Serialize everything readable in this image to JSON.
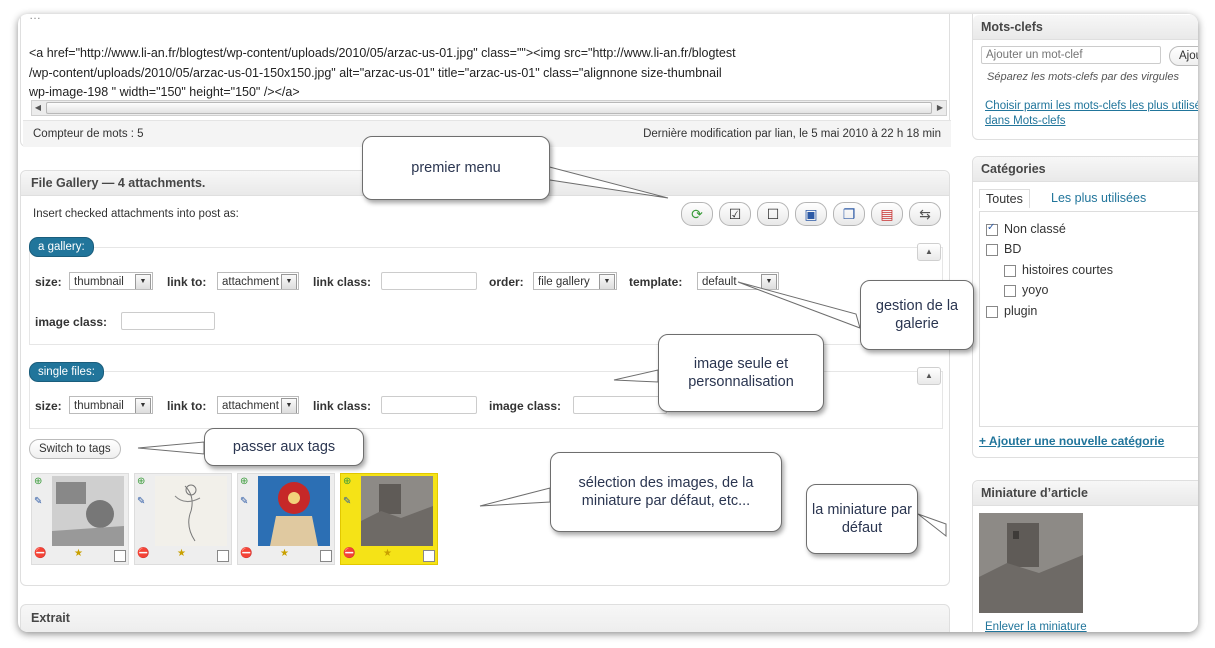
{
  "editor": {
    "code_line1": "<a href=\"http://www.li-an.fr/blogtest/wp-content/uploads/2010/05/arzac-us-01.jpg\" class=\"\"><img src=\"http://www.li-an.fr/blogtest",
    "code_line2": "/wp-content/uploads/2010/05/arzac-us-01-150x150.jpg\" alt=\"arzac-us-01\" title=\"arzac-us-01\"  class=\"alignnone size-thumbnail",
    "code_line3": "wp-image-198 \" width=\"150\" height=\"150\" /></a>",
    "word_count": "Compteur de mots : 5",
    "last_modified": "Dernière modification par lian, le 5 mai 2010 à 22 h 18 min"
  },
  "gallery": {
    "title": "File Gallery — 4 attachments.",
    "insert_label": "Insert checked attachments into post as:",
    "toolbar_icons": [
      "refresh-icon",
      "check-all-icon",
      "uncheck-all-icon",
      "insert-icon",
      "copy-icon",
      "save-icon",
      "swap-icon"
    ],
    "gallery_pill": "a gallery:",
    "single_pill": "single files:",
    "size_label": "size:",
    "link_to_label": "link to:",
    "link_class_label": "link class:",
    "order_label": "order:",
    "template_label": "template:",
    "image_class_label": "image class:",
    "size_value": "thumbnail",
    "link_to_value": "attachment",
    "order_value": "file gallery",
    "template_value": "default",
    "switch_button": "Switch to tags"
  },
  "callouts": {
    "premier_menu": "premier menu",
    "gestion": "gestion de la galerie",
    "image_seule": "image seule et personnalisation",
    "passer": "passer aux tags",
    "selection": "sélection des images, de la miniature par défaut, etc...",
    "miniature": "la miniature par défaut"
  },
  "tags_box": {
    "title": "Mots-clefs",
    "placeholder": "Ajouter un mot-clef",
    "add_button": "Ajouter",
    "hint": "Séparez les mots-clefs par des virgules",
    "choose_link": "Choisir parmi les mots-clefs les plus utilisés dans Mots-clefs"
  },
  "categories_box": {
    "title": "Catégories",
    "tab_all": "Toutes",
    "tab_popular": "Les plus utilisées",
    "items": [
      {
        "label": "Non classé",
        "checked": true
      },
      {
        "label": "BD",
        "checked": false
      },
      {
        "label": "histoires courtes",
        "checked": false
      },
      {
        "label": "yoyo",
        "checked": false
      },
      {
        "label": "plugin",
        "checked": false
      }
    ],
    "add_link": "+ Ajouter une nouvelle catégorie"
  },
  "thumbnail_box": {
    "title": "Miniature d’article",
    "remove_link": "Enlever la miniature"
  },
  "excerpt_box": {
    "title": "Extrait"
  }
}
